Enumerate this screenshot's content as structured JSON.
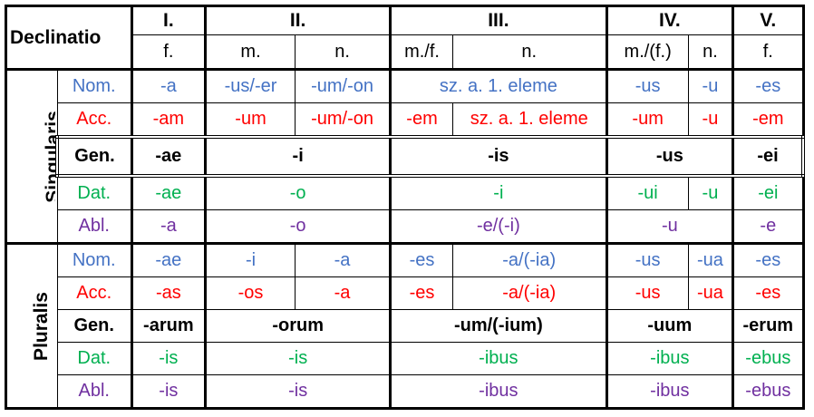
{
  "header": {
    "declinatio_label": "Declinatio",
    "decl_1": "I.",
    "decl_2": "II.",
    "decl_3": "III.",
    "decl_4": "IV.",
    "decl_5": "V.",
    "gender_1f": "f.",
    "gender_2m": "m.",
    "gender_2n": "n.",
    "gender_3mf": "m./f.",
    "gender_3n": "n.",
    "gender_4mf": "m./(f.)",
    "gender_4n": "n.",
    "gender_5f": "f."
  },
  "singular": {
    "label": "Singularis",
    "nom": {
      "case": "Nom.",
      "d1": "-a",
      "d2m": "-us/-er",
      "d2n": "-um/-on",
      "d3": "sz. a. 1. eleme",
      "d4mf": "-us",
      "d4n": "-u",
      "d5": "-es"
    },
    "acc": {
      "case": "Acc.",
      "d1": "-am",
      "d2m": "-um",
      "d2n": "-um/-on",
      "d3mf": "-em",
      "d3n": "sz. a. 1. eleme",
      "d4mf": "-um",
      "d4n": "-u",
      "d5": "-em"
    },
    "gen": {
      "case": "Gen.",
      "d1": "-ae",
      "d2": "-i",
      "d3": "-is",
      "d4": "-us",
      "d5": "-ei"
    },
    "dat": {
      "case": "Dat.",
      "d1": "-ae",
      "d2": "-o",
      "d3": "-i",
      "d4mf": "-ui",
      "d4n": "-u",
      "d5": "-ei"
    },
    "abl": {
      "case": "Abl.",
      "d1": "-a",
      "d2": "-o",
      "d3": "-e/(-i)",
      "d4": "-u",
      "d5": "-e"
    }
  },
  "plural": {
    "label": "Pluralis",
    "nom": {
      "case": "Nom.",
      "d1": "-ae",
      "d2m": "-i",
      "d2n": "-a",
      "d3mf": "-es",
      "d3n": "-a/(-ia)",
      "d4mf": "-us",
      "d4n": "-ua",
      "d5": "-es"
    },
    "acc": {
      "case": "Acc.",
      "d1": "-as",
      "d2m": "-os",
      "d2n": "-a",
      "d3mf": "-es",
      "d3n": "-a/(-ia)",
      "d4mf": "-us",
      "d4n": "-ua",
      "d5": "-es"
    },
    "gen": {
      "case": "Gen.",
      "d1": "-arum",
      "d2": "-orum",
      "d3": "-um/(-ium)",
      "d4": "-uum",
      "d5": "-erum"
    },
    "dat": {
      "case": "Dat.",
      "d1": "-is",
      "d2": "-is",
      "d3": "-ibus",
      "d4": "-ibus",
      "d5": "-ebus"
    },
    "abl": {
      "case": "Abl.",
      "d1": "-is",
      "d2": "-is",
      "d3": "-ibus",
      "d4": "-ibus",
      "d5": "-ebus"
    }
  },
  "colors": {
    "nom": "#4472c4",
    "acc": "#ff0000",
    "gen": "#000000",
    "dat": "#00b050",
    "abl": "#7030a0"
  }
}
